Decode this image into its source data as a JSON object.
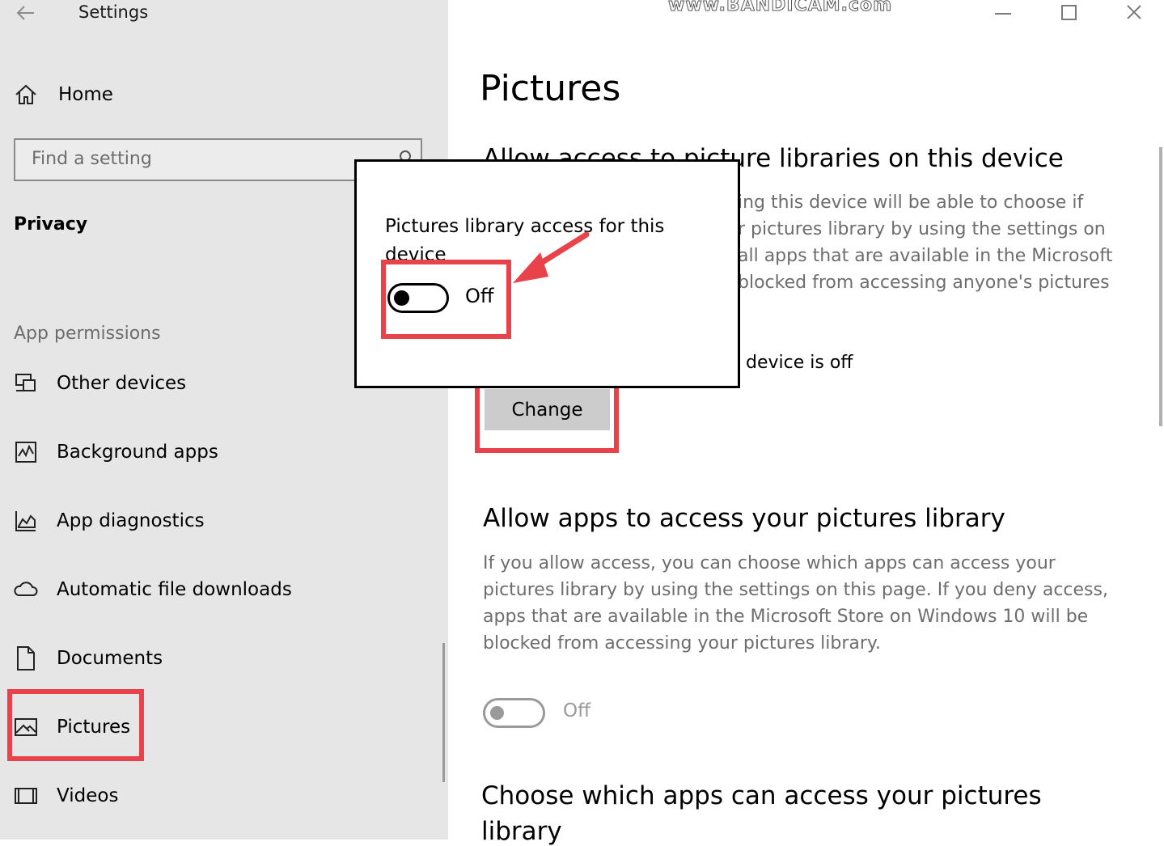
{
  "window": {
    "title": "Settings",
    "watermark": "www.BANDICAM.com",
    "controls": {
      "minimize": "minimize-icon",
      "maximize": "maximize-icon",
      "close": "close-icon"
    }
  },
  "sidebar": {
    "home_label": "Home",
    "search_placeholder": "Find a setting",
    "section_title": "Privacy",
    "group_title": "App permissions",
    "items": [
      {
        "label": "Other devices",
        "icon": "devices-icon"
      },
      {
        "label": "Background apps",
        "icon": "background-apps-icon"
      },
      {
        "label": "App diagnostics",
        "icon": "diagnostics-icon"
      },
      {
        "label": "Automatic file downloads",
        "icon": "cloud-icon"
      },
      {
        "label": "Documents",
        "icon": "document-icon"
      },
      {
        "label": "Pictures",
        "icon": "picture-icon",
        "selected": true
      },
      {
        "label": "Videos",
        "icon": "video-icon"
      }
    ]
  },
  "main": {
    "page_title": "Pictures",
    "section1": {
      "heading": "Allow access to picture libraries on this device",
      "desc_lines": [
        "ing this device will be able to choose if",
        "r pictures library by using the settings on",
        "all apps that are available in the Microsoft",
        "blocked from accessing anyone's pictures"
      ],
      "status": "device is off",
      "change_label": "Change"
    },
    "section2": {
      "heading": "Allow apps to access your pictures library",
      "description": "If you allow access, you can choose which apps can access your pictures library by using the settings on this page. If you deny access, apps that are available in the Microsoft Store on Windows 10 will be blocked from accessing your pictures library.",
      "toggle_state": "Off"
    },
    "section3": {
      "heading_line1": "Choose which apps can access your pictures",
      "heading_line2": "library"
    }
  },
  "popup": {
    "text": "Pictures library access for this device",
    "toggle_state": "Off"
  },
  "colors": {
    "highlight": "#e8424a",
    "sidebar_bg": "#e6e6e6",
    "button_bg": "#cccccc"
  }
}
